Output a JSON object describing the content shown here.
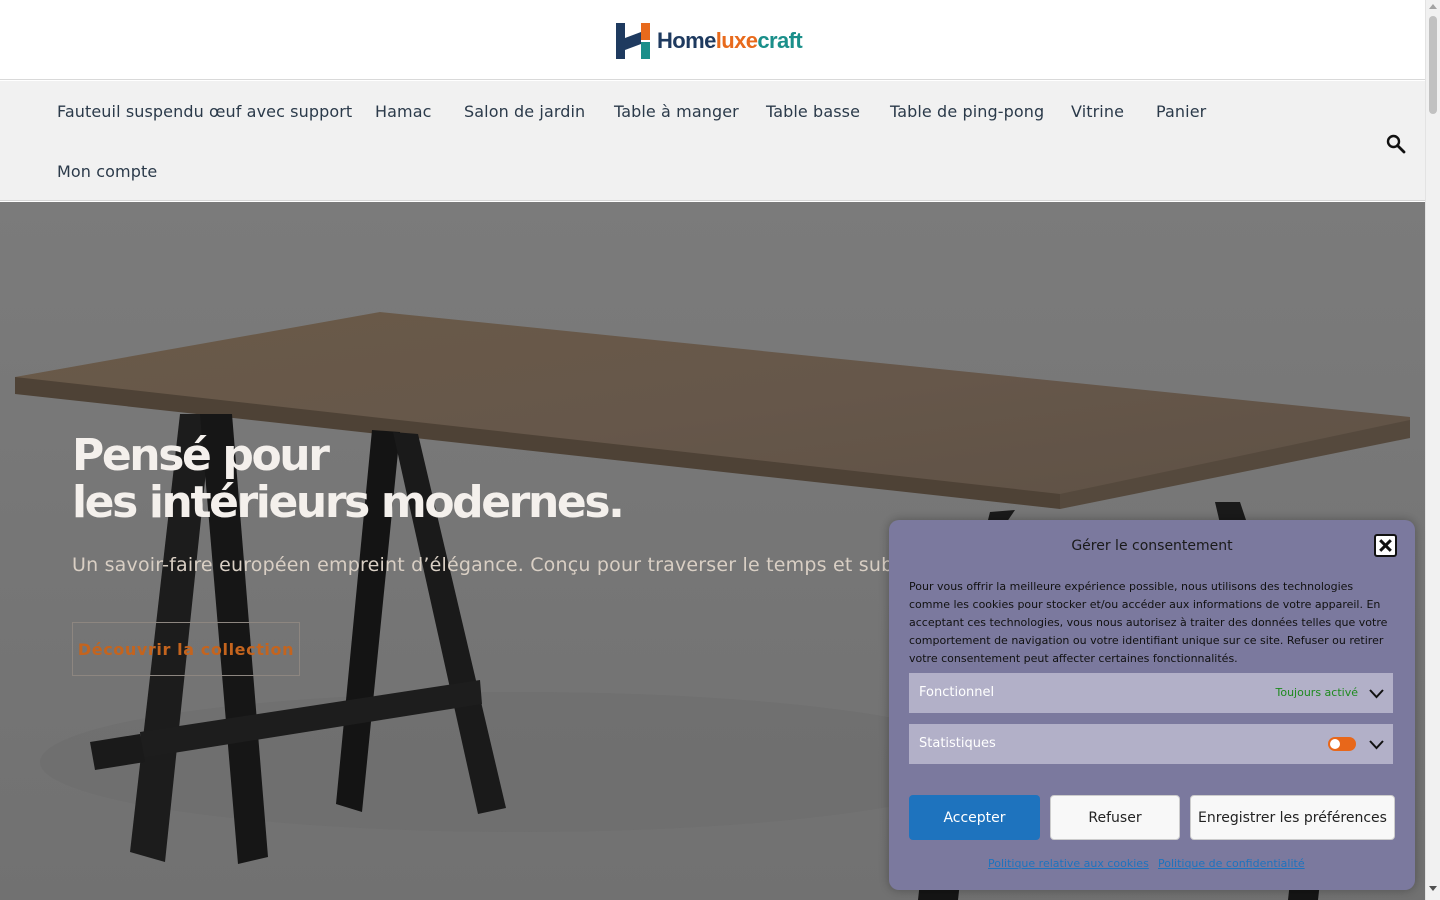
{
  "brand": {
    "logo_part1": "Home",
    "logo_part2": "luxe",
    "logo_part3": "craft",
    "colors": {
      "navy": "#1e3a5f",
      "orange": "#e86a1c",
      "teal": "#1a8f8a"
    }
  },
  "nav": {
    "items": [
      "Fauteuil suspendu œuf avec support",
      "Hamac",
      "Salon de jardin",
      "Table à manger",
      "Table basse",
      "Table de ping-pong",
      "Vitrine",
      "Panier",
      "Mon compte"
    ],
    "search_icon": "search-icon"
  },
  "hero": {
    "title_line1": "Pensé pour",
    "title_line2": "les intérieurs modernes.",
    "subtitle": "Un savoir-faire européen empreint d’élégance. Conçu pour traverser le temps et sublimer votre intérieur.",
    "cta": "Découvrir la collection"
  },
  "consent": {
    "title": "Gérer le consentement",
    "message": "Pour vous offrir la meilleure expérience possible, nous utilisons des technologies comme les cookies pour stocker et/ou accéder aux informations de votre appareil. En acceptant ces technologies, vous nous autorisez à traiter des données telles que votre comportement de navigation ou votre identifiant unique sur ce site. Refuser ou retirer votre consentement peut affecter certaines fonctionnalités.",
    "categories": [
      {
        "label": "Fonctionnel",
        "status": "Toujours activé"
      },
      {
        "label": "Statistiques",
        "enabled": false
      }
    ],
    "accept": "Accepter",
    "deny": "Refuser",
    "save": "Enregistrer les préférences",
    "link_cookies": "Politique relative aux cookies",
    "link_privacy": "Politique de confidentialité",
    "accent_color": "#1e73be",
    "toggle_color": "#e8671a"
  }
}
